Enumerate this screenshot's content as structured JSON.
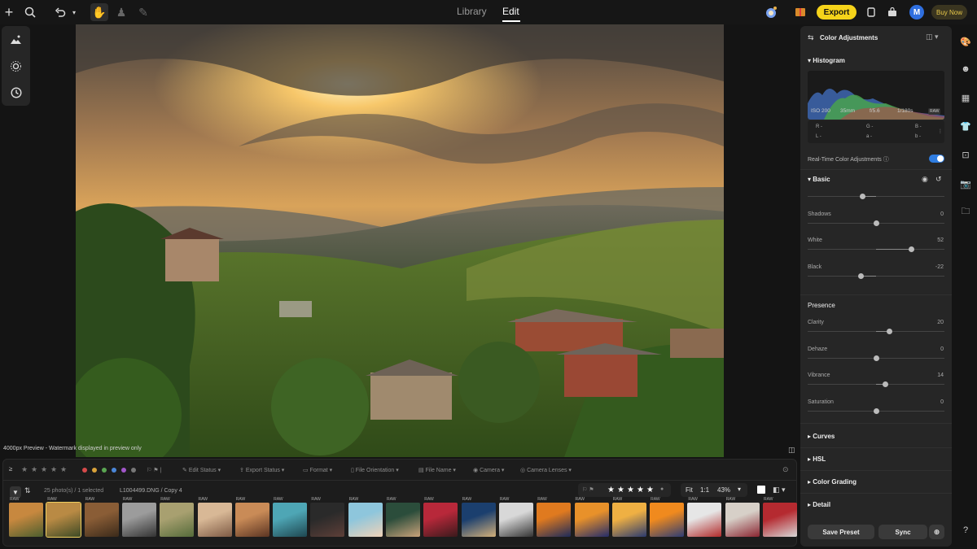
{
  "header": {
    "tabs": [
      {
        "label": "Library"
      },
      {
        "label": "Edit"
      }
    ],
    "active_tab": "Edit",
    "export_label": "Export",
    "buy_now_label": "Buy Now",
    "avatar_initial": "M",
    "icons": [
      "plus-icon",
      "search-icon",
      "undo-icon",
      "chevron-down-icon",
      "hand-icon",
      "stamp-icon",
      "brush-icon",
      "ai-assistant-icon",
      "gift-icon",
      "phone-icon",
      "bag-icon"
    ]
  },
  "left_tools": [
    "landscape-ai-icon",
    "sun-effects-icon",
    "history-icon"
  ],
  "canvas": {
    "preview_note": "4000px Preview - Watermark displayed in preview only"
  },
  "filmstrip": {
    "filters": [
      "Edit Status",
      "Export Status",
      "Format",
      "File Orientation",
      "File Name",
      "Camera",
      "Camera Lenses"
    ],
    "photo_count": "25 photo(s) / 1 selected",
    "file_name": "L1004499.DNG / Copy 4",
    "zoom": {
      "fit": "Fit",
      "one_to_one": "1:1",
      "percent": "43%"
    },
    "label_colors": [
      "#d54a4a",
      "#d9a23a",
      "#5aa552",
      "#4a86d8",
      "#a156c9",
      "#777777"
    ],
    "thumb_badge": "RAW",
    "thumbnail_colors": [
      [
        "#c7883f",
        "#4c5e2e"
      ],
      [
        "#b98a44",
        "#3d4a25"
      ],
      [
        "#8a5d36",
        "#3b2a1a"
      ],
      [
        "#9c9c9c",
        "#333333"
      ],
      [
        "#a8a070",
        "#556b3a"
      ],
      [
        "#d8b896",
        "#7e5a44"
      ],
      [
        "#c98b57",
        "#5b3422"
      ],
      [
        "#4ea6b5",
        "#1e4750"
      ],
      [
        "#2a2a2a",
        "#5e3f38"
      ],
      [
        "#8ec6dc",
        "#f0d2b8"
      ],
      [
        "#2b4d3b",
        "#c9a27a"
      ],
      [
        "#b8283a",
        "#3a1a1c"
      ],
      [
        "#1b3f6e",
        "#d3b07a"
      ],
      [
        "#d8d8d8",
        "#333333"
      ],
      [
        "#e07a1f",
        "#1c2a5a"
      ],
      [
        "#e8912a",
        "#232c6a"
      ],
      [
        "#efb043",
        "#2a3a6e"
      ],
      [
        "#f08a1e",
        "#2c3c74"
      ],
      [
        "#e6e6e6",
        "#b22a2a"
      ],
      [
        "#d7d0c8",
        "#8a2430"
      ],
      [
        "#b52a30",
        "#d7d7d7"
      ]
    ]
  },
  "right_panel": {
    "title": "Color Adjustments",
    "histogram": {
      "label": "Histogram",
      "iso": "ISO 200",
      "focal": "35mm",
      "aperture": "f/5.6",
      "shutter": "1/180s",
      "format": "RAW",
      "readout_top": [
        "R -",
        "G -",
        "B -"
      ],
      "readout_bottom": [
        "L -",
        "a -",
        "b -"
      ]
    },
    "realtime_label": "Real-Time Color Adjustments",
    "realtime_on": true,
    "basic_label": "Basic",
    "basic_sliders": [
      {
        "label": "",
        "value": "",
        "level": -0.2
      },
      {
        "label": "Shadows",
        "value": "0",
        "level": 0
      },
      {
        "label": "White",
        "value": "52",
        "level": 0.52
      },
      {
        "label": "Black",
        "value": "-22",
        "level": -0.22
      }
    ],
    "presence_label": "Presence",
    "presence_sliders": [
      {
        "label": "Clarity",
        "value": "20",
        "level": 0.2
      },
      {
        "label": "Dehaze",
        "value": "0",
        "level": 0
      },
      {
        "label": "Vibrance",
        "value": "14",
        "level": 0.14
      },
      {
        "label": "Saturation",
        "value": "0",
        "level": 0
      }
    ],
    "collapsed_sections": [
      "Curves",
      "HSL",
      "Color Grading",
      "Detail"
    ],
    "save_preset_label": "Save Preset",
    "sync_label": "Sync"
  },
  "far_right_tools": [
    "palette-icon",
    "face-icon",
    "pattern-icon",
    "shirt-icon",
    "crop-icon",
    "camera-icon",
    "folder-icon",
    "help-icon"
  ],
  "colors": {
    "accent": "#f5d31a",
    "toggle": "#2f7de1"
  }
}
